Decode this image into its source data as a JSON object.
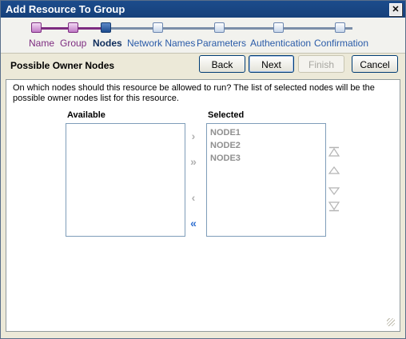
{
  "window": {
    "title": "Add Resource To Group",
    "close_label": "✕"
  },
  "wizard": {
    "steps": [
      {
        "label": "Name",
        "state": "done"
      },
      {
        "label": "Group",
        "state": "done"
      },
      {
        "label": "Nodes",
        "state": "current"
      },
      {
        "label": "Network Names",
        "state": "pending"
      },
      {
        "label": "Parameters",
        "state": "pending"
      },
      {
        "label": "Authentication",
        "state": "pending"
      },
      {
        "label": "Confirmation",
        "state": "pending"
      }
    ]
  },
  "page": {
    "title": "Possible Owner Nodes",
    "instruction": "On which nodes should this resource be allowed to run?  The list of selected nodes will be the possible owner nodes list for this resource."
  },
  "buttons": {
    "back": "Back",
    "next": "Next",
    "finish": "Finish",
    "cancel": "Cancel"
  },
  "available": {
    "label": "Available",
    "items": []
  },
  "selected": {
    "label": "Selected",
    "items": [
      "NODE1",
      "NODE2",
      "NODE3"
    ]
  },
  "arrows": {
    "add": "›",
    "add_all": "»",
    "remove": "‹",
    "remove_all": "«"
  },
  "colors": {
    "titlebar": "#1c4c8c",
    "step_done": "#7d2c80",
    "step_current": "#0f2d5c",
    "step_pending": "#2a5ba8"
  }
}
